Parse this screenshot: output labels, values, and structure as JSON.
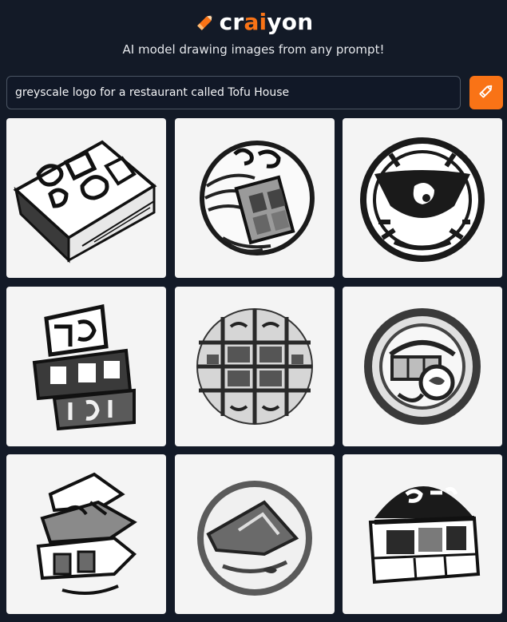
{
  "brand": {
    "prefix": "cr",
    "accent": "ai",
    "suffix": "yon",
    "accent_color": "#f97316",
    "logo_icon": "pencil-icon"
  },
  "subtitle": "AI model drawing images from any prompt!",
  "prompt": {
    "value": "greyscale logo for a restaurant called Tofu House"
  },
  "draw_button": {
    "icon": "pencil-icon",
    "color": "#f97316"
  },
  "images": [
    {
      "name": "result-image-1"
    },
    {
      "name": "result-image-2"
    },
    {
      "name": "result-image-3"
    },
    {
      "name": "result-image-4"
    },
    {
      "name": "result-image-5"
    },
    {
      "name": "result-image-6"
    },
    {
      "name": "result-image-7"
    },
    {
      "name": "result-image-8"
    },
    {
      "name": "result-image-9"
    }
  ]
}
